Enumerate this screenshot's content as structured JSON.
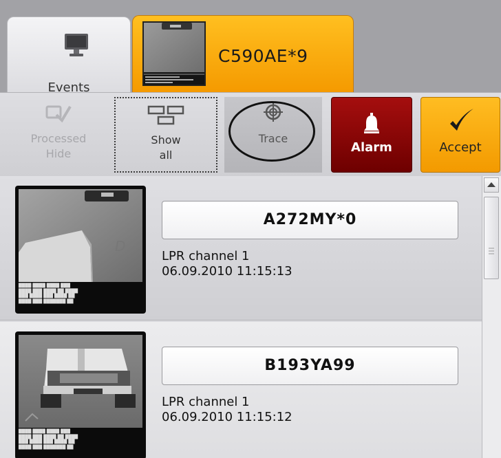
{
  "tabs": {
    "events": {
      "label": "Events",
      "icon": "monitor-icon"
    },
    "plate_tab": {
      "label": "C590AE*9",
      "icon": "camera-thumbnail"
    }
  },
  "toolbar": {
    "processed_hide": {
      "line1": "Processed",
      "line2": "Hide",
      "icon": "check-doc-icon",
      "enabled": false
    },
    "show_all": {
      "line1": "Show",
      "line2": "all",
      "icon": "windows-icon"
    },
    "trace": {
      "label": "Trace",
      "icon": "crosshair-icon"
    },
    "alarm": {
      "label": "Alarm",
      "icon": "bell-icon",
      "color": "#8e0000"
    },
    "accept": {
      "label": "Accept",
      "icon": "checkmark-icon",
      "color": "#f7a50a"
    }
  },
  "events": [
    {
      "plate": "A272MY*0",
      "channel": "LPR channel 1",
      "timestamp": "06.09.2010 11:15:13"
    },
    {
      "plate": "B193YA99",
      "channel": "LPR channel 1",
      "timestamp": "06.09.2010 11:15:12"
    }
  ],
  "colors": {
    "accent_orange": "#f7a50a",
    "alarm_red": "#8e0000",
    "background": "#a2a2a6"
  }
}
